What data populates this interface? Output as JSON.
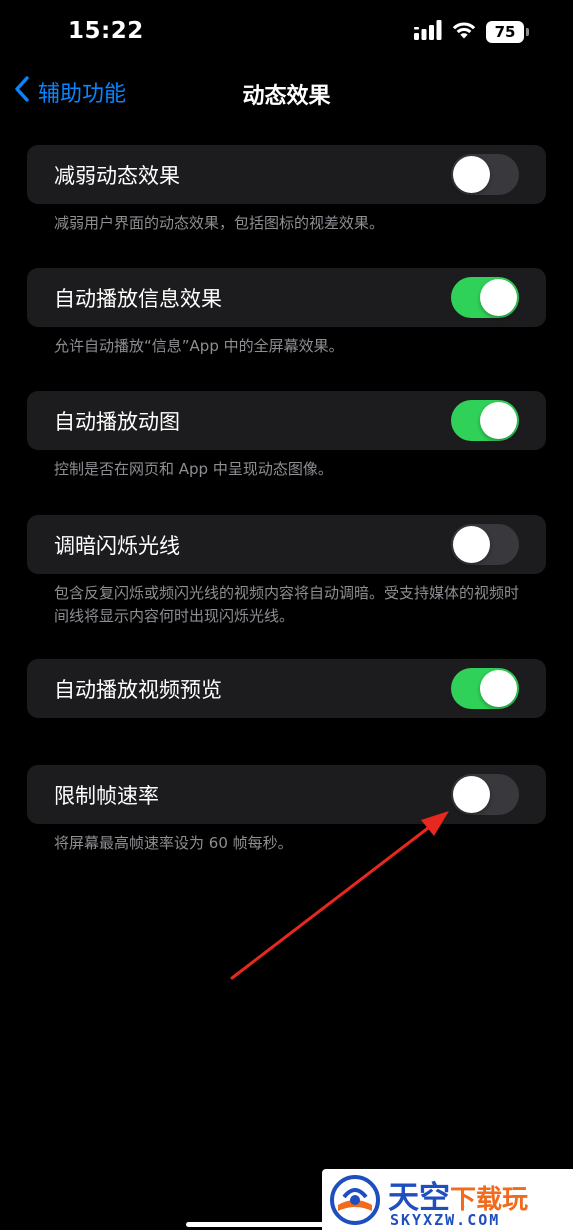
{
  "status_bar": {
    "time": "15:22",
    "battery_level": "75",
    "signal_icon": "cellular-signal-icon",
    "wifi_icon": "wifi-icon"
  },
  "nav": {
    "back_label": "辅助功能",
    "title": "动态效果",
    "accent_color": "#0a84ff"
  },
  "settings": [
    {
      "label": "减弱动态效果",
      "on": false,
      "footer": "减弱用户界面的动态效果，包括图标的视差效果。"
    },
    {
      "label": "自动播放信息效果",
      "on": true,
      "footer": "允许自动播放“信息”App 中的全屏幕效果。"
    },
    {
      "label": "自动播放动图",
      "on": true,
      "footer": "控制是否在网页和 App 中呈现动态图像。"
    },
    {
      "label": "调暗闪烁光线",
      "on": false,
      "footer": "包含反复闪烁或频闪光线的视频内容将自动调暗。受支持媒体的视频时间线将显示内容何时出现闪烁光线。"
    },
    {
      "label": "自动播放视频预览",
      "on": true,
      "footer": ""
    },
    {
      "label": "限制帧速率",
      "on": false,
      "footer": "将屏幕最高帧速率设为 60 帧每秒。"
    }
  ],
  "colors": {
    "toggle_on": "#30d158",
    "toggle_off": "#39393d",
    "cell_bg": "#1c1c1e",
    "footer_text": "#8e8e93",
    "arrow": "#e8281e"
  },
  "watermark": {
    "title_main": "天空",
    "title_accent": "下载玩",
    "subtitle": "SKYXZW.COM"
  }
}
